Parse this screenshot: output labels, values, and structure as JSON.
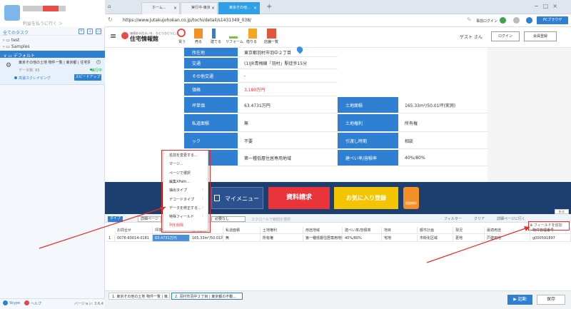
{
  "sidebar": {
    "promo": "利益を払うに行く ＞",
    "tasks_title": "全てのタスク",
    "tree": [
      "test",
      "Samples"
    ],
    "default_label": "デフォルト",
    "task": {
      "title": "東京その他の土地 物件一覧 | 東京都 | 住宅情",
      "data": "データ数: 65",
      "running": "実行中",
      "speed": "高速スクレイピング",
      "speedup": "スピードアップ"
    },
    "footer": {
      "skype": "Skype",
      "help": "ヘルプ",
      "version": "バージョン: 3.6.4"
    }
  },
  "browser": {
    "tabs": [
      "ホーム...",
      "実行中-東京",
      "東京その他..."
    ],
    "url": "https://www.jutakujohokan.co.jp/tochi/detail/s1431349_038/",
    "login_link": "事前ログイン",
    "pc_browser": "PCブラウザ"
  },
  "site": {
    "logo_sub": "価値ある住まいを、ひとりひとりに。",
    "logo": "住宅情報館",
    "nav": [
      "買う",
      "売る",
      "建てる",
      "リフォーム",
      "借りる",
      "店舗一覧"
    ],
    "guest": "ゲスト さん",
    "login": "ログイン",
    "register": "会員登録"
  },
  "detail": {
    "rows": [
      {
        "label": "所在地",
        "value": "東京都羽村市羽中２丁目"
      },
      {
        "label": "交通",
        "value": "(1)JR青梅線「羽村」駅徒歩15分"
      },
      {
        "label": "その他交通",
        "value": "-"
      },
      {
        "label": "価格",
        "value": "3,180万円",
        "red": true
      },
      {
        "label": "坪単価",
        "value": "63.4731万円",
        "label2": "土地面積",
        "value2": "165.33m²/50.01坪(実測)"
      },
      {
        "label": "私道面積",
        "value": "無",
        "label2": "土地権利",
        "value2": "所有権"
      },
      {
        "label": "ック",
        "value": "不要",
        "label2": "引渡し時期",
        "value2": "相談"
      },
      {
        "label": "",
        "value": "第一種低層住居専用地域",
        "label2": "建ぺい率/容積率",
        "value2": "40%/80%"
      }
    ]
  },
  "banner": {
    "mymenu": "マイメニュー",
    "docreq": "資料請求",
    "fav": "お気に入り登録",
    "free": "相談無料"
  },
  "panel": {
    "collapse": "折る",
    "tabs": [
      "タイプ",
      "詳細ページ"
    ],
    "select": "必要なし",
    "scroll": "スクロールで範囲を選択",
    "filter": "フィルター",
    "clear": "クリア",
    "detailgo": "詳細ページに行く",
    "add_field": "フィールドを追加",
    "columns": [
      "お問合せ",
      "坪単価",
      "土地面積",
      "私道面積",
      "土地権利",
      "用途地域",
      "建ぺい率/容積率",
      "地目",
      "都市計画",
      "現況",
      "最適用途",
      "物件管理番号"
    ],
    "row_no": "1",
    "row": [
      "0078-60014-0181",
      "63.4731万円",
      "165.33m²/50.01坪",
      "無",
      "所有権",
      "第一種低層住居専用地域",
      "40%/80%",
      "宅地",
      "市街化区域",
      "更地",
      "戸建用地",
      "g000591897"
    ]
  },
  "context_menu": {
    "items": [
      "名前を変更する...",
      "マージ...",
      "ページで選択",
      "編集XPath...",
      "抽出タイプ",
      "デコードタイプ",
      "データを修正する...",
      "特殊フィールド",
      "列を削除"
    ],
    "submenu": [
      false,
      false,
      false,
      false,
      true,
      true,
      true,
      true,
      false
    ]
  },
  "bottom": {
    "tabs": [
      "1. 東京その他の土地 物件一覧 | 東...",
      "2. 羽村市羽中２丁目 | 東京都の不動..."
    ],
    "start": "▶ 起動",
    "save": "保存"
  }
}
